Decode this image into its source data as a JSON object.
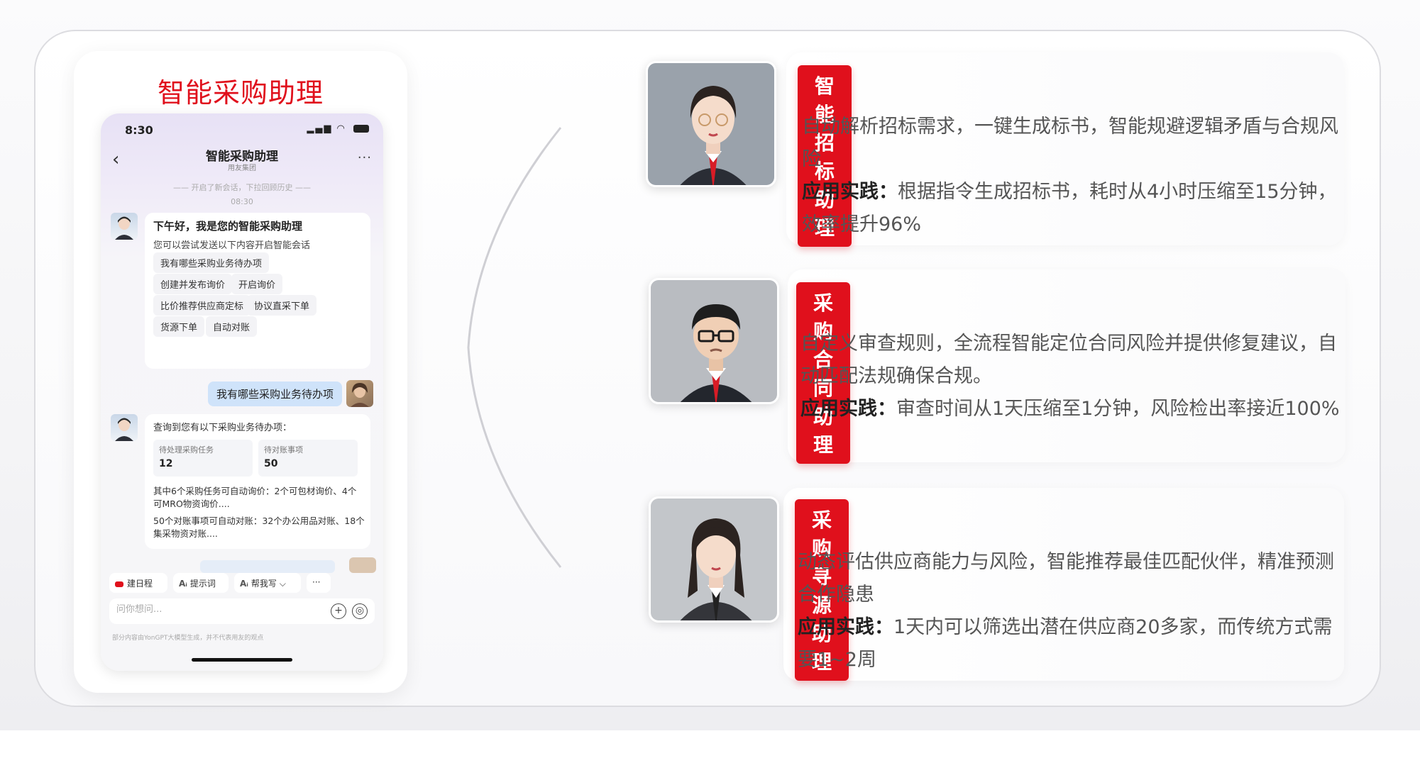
{
  "phone_card": {
    "title": "智能采购助理",
    "status_time": "8:30",
    "chat_title": "智能采购助理",
    "chat_subtitle": "用友集团",
    "history_hint": "—— 开启了新会话，下拉回顾历史 ——",
    "history_time": "08:30",
    "greeting": "下午好，我是您的智能采购助理",
    "greeting_sub": "您可以尝试发送以下内容开启智能会话",
    "chips": [
      "我有哪些采购业务待办项",
      "创建并发布询价",
      "开启询价",
      "比价推荐供应商定标",
      "协议直采下单",
      "货源下单",
      "自动对账"
    ],
    "user_message": "我有哪些采购业务待办项",
    "response_title": "查询到您有以下采购业务待办项：",
    "stats": [
      {
        "label": "待处理采购任务",
        "value": "12"
      },
      {
        "label": "待对账事项",
        "value": "50"
      }
    ],
    "response_para1": "其中6个采购任务可自动询价：2个可包材询价、4个可MRO物资询价....",
    "response_para2": "50个对账事项可自动对账：32个办公用品对账、18个集采物资对账....",
    "tools": {
      "schedule": "建日程",
      "prompt": "提示词",
      "write": "帮我写",
      "more": "···"
    },
    "input_placeholder": "问你想问...",
    "disclaimer": "部分内容由YonGPT大模型生成，并不代表用友的观点"
  },
  "assistants": [
    {
      "tag": "智能招标助理",
      "description": "自动解析招标需求，一键生成标书，智能规避逻辑矛盾与合规风险",
      "practice_label": "应用实践：",
      "practice": "根据指令生成招标书，耗时从4小时压缩至15分钟，效率提升96%"
    },
    {
      "tag": "采购合同助理",
      "description": "自定义审查规则，全流程智能定位合同风险并提供修复建议，自动匹配法规确保合规。",
      "practice_label": "应用实践：",
      "practice": "审查时间从1天压缩至1分钟，风险检出率接近100%"
    },
    {
      "tag": "采购寻源助理",
      "description": "动态评估供应商能力与风险，智能推荐最佳匹配伙伴，精准预测合作隐患",
      "practice_label": "应用实践：",
      "practice": "1天内可以筛选出潜在供应商20多家，而传统方式需要1~2周"
    }
  ],
  "colors": {
    "accent_red": "#e0101c",
    "user_bubble": "#cfe3fa"
  }
}
